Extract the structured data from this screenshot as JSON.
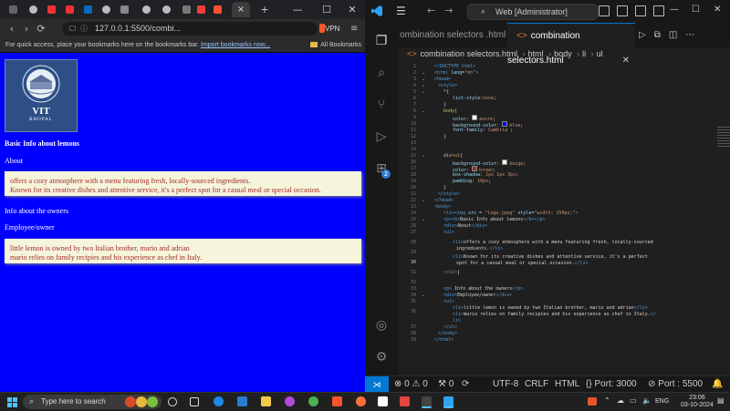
{
  "browser": {
    "address": "127.0.0.1:5500/combi...",
    "vpn_label": "VPN",
    "bookmarks_prompt": "For quick access, place your bookmarks here on the bookmarks bar.",
    "bookmarks_link": "Import bookmarks now...",
    "all_bookmarks": "All Bookmarks",
    "active_tab_label": "×",
    "page": {
      "logo_name": "VIT",
      "logo_city": "BHOPAL",
      "heading": "Basic Info about lemons",
      "about": "About",
      "list1": [
        "offers a cozy atmosphere with a menu featuring fresh, locally-sourced ingredients.",
        "Known for its creative dishes and attentive service, it's a perfect spot for a casual meal or special occasion."
      ],
      "owners": "Info about the owners",
      "employee": "Employee/owner",
      "list2": [
        "little lemon is owned by two Italian brother, mario and adrian",
        "mario relies on family recipies and his experience as chef in Italy."
      ]
    }
  },
  "vscode": {
    "search": "Web [Administrator]",
    "tab_inactive": "ombination selectors .html",
    "tab_active": "combination selectors.html",
    "breadcrumb": [
      "combination selectors.html",
      "html",
      "body",
      "li",
      "ul"
    ],
    "source_badge": "2",
    "status": {
      "errors": "0",
      "warnings": "0",
      "info": "0",
      "encoding": "UTF-8",
      "eol": "CRLF",
      "language": "HTML",
      "port1": "Port: 3000",
      "port2": "Port : 5500"
    },
    "lines": [
      "1",
      "2",
      "3",
      "4",
      "5",
      "6",
      "7",
      "8",
      "9",
      "10",
      "11",
      "12",
      "13",
      "14",
      "15",
      "16",
      "17",
      "18",
      "19",
      "20",
      "21",
      "22",
      "23",
      "24",
      "25",
      "26",
      "27",
      "28",
      "29",
      "30",
      "31",
      "32",
      "33",
      "34",
      "35",
      "36",
      "37",
      "38",
      "39"
    ]
  },
  "taskbar": {
    "search": "Type here to search",
    "lang": "ENG",
    "time": "23:06",
    "date": "03-10-2024"
  },
  "colors": {
    "page_bg": "#0000ff",
    "list_bg": "#f5f5dc",
    "list_text": "#a52a2a",
    "vscode_accent": "#0078d4"
  }
}
